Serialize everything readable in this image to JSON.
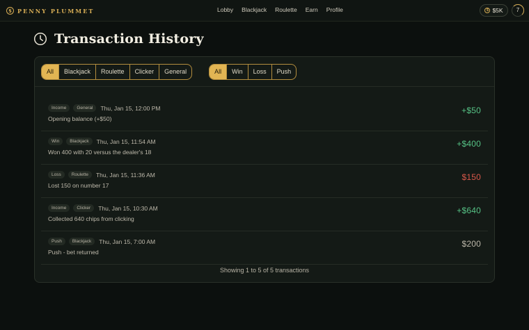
{
  "brand": {
    "name": "PENNY PLUMMET",
    "coin_glyph": "$"
  },
  "nav": {
    "items": [
      "Lobby",
      "Blackjack",
      "Roulette",
      "Earn",
      "Profile"
    ]
  },
  "header": {
    "balance": "$5K",
    "balance_coin_glyph": "$",
    "level": "7"
  },
  "page": {
    "title": "Transaction History"
  },
  "filters": {
    "game": {
      "options": [
        "All",
        "Blackjack",
        "Roulette",
        "Clicker",
        "General"
      ],
      "selected": "All"
    },
    "result": {
      "options": [
        "All",
        "Win",
        "Loss",
        "Push"
      ],
      "selected": "All"
    }
  },
  "transactions": [
    {
      "tags": [
        "Income",
        "General"
      ],
      "time": "Thu, Jan 15, 12:00 PM",
      "description": "Opening balance (+$50)",
      "amount": "+$50",
      "kind": "positive"
    },
    {
      "tags": [
        "Win",
        "Blackjack"
      ],
      "time": "Thu, Jan 15, 11:54 AM",
      "description": "Won 400 with 20 versus the dealer's 18",
      "amount": "+$400",
      "kind": "positive"
    },
    {
      "tags": [
        "Loss",
        "Roulette"
      ],
      "time": "Thu, Jan 15, 11:36 AM",
      "description": "Lost 150 on number 17",
      "amount": "$150",
      "kind": "negative"
    },
    {
      "tags": [
        "Income",
        "Clicker"
      ],
      "time": "Thu, Jan 15, 10:30 AM",
      "description": "Collected 640 chips from clicking",
      "amount": "+$640",
      "kind": "positive"
    },
    {
      "tags": [
        "Push",
        "Blackjack"
      ],
      "time": "Thu, Jan 15, 7:00 AM",
      "description": "Push - bet returned",
      "amount": "$200",
      "kind": "neutral"
    }
  ],
  "summary": "Showing 1 to 5 of 5 transactions",
  "colors": {
    "accent": "#e2b553",
    "positive": "#56c285",
    "negative": "#d9584a",
    "background": "#0c100e"
  },
  "icons": {
    "title_icon": "clock-icon",
    "balance_icon": "coin-icon"
  }
}
